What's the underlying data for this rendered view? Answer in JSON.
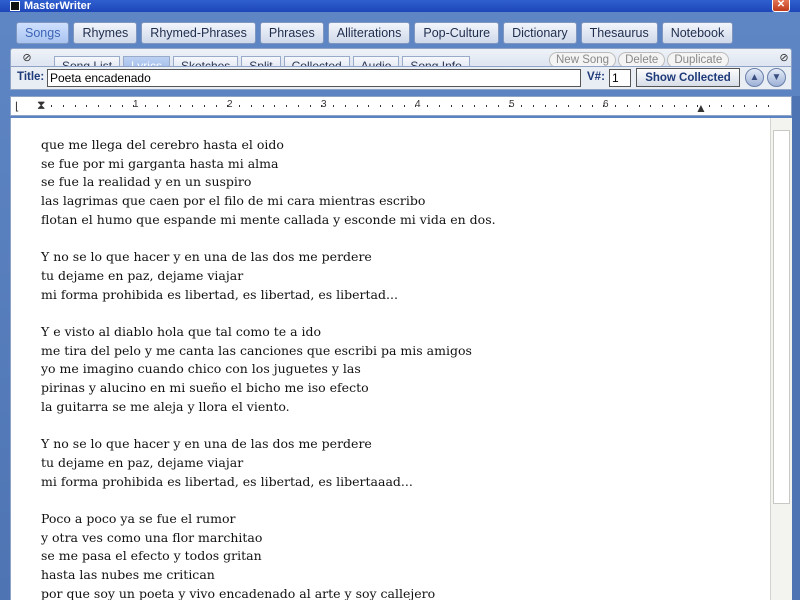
{
  "window": {
    "title": "MasterWriter"
  },
  "categories": [
    {
      "label": "Songs",
      "active": true
    },
    {
      "label": "Rhymes"
    },
    {
      "label": "Rhymed-Phrases"
    },
    {
      "label": "Phrases"
    },
    {
      "label": "Alliterations"
    },
    {
      "label": "Pop-Culture"
    },
    {
      "label": "Dictionary"
    },
    {
      "label": "Thesaurus"
    },
    {
      "label": "Notebook"
    }
  ],
  "song_tabs": [
    {
      "label": "Song List"
    },
    {
      "label": "Lyrics",
      "active": true
    },
    {
      "label": "Sketches"
    },
    {
      "label": "Split"
    },
    {
      "label": "Collected"
    },
    {
      "label": "Audio"
    },
    {
      "label": "Song Info"
    }
  ],
  "song_actions": {
    "new_song": "New Song",
    "delete": "Delete",
    "duplicate": "Duplicate"
  },
  "title_row": {
    "title_label": "Title:",
    "title_value": "Poeta encadenado",
    "version_label": "V#:",
    "version_value": "1",
    "show_collected": "Show Collected"
  },
  "ruler": {
    "numbers": [
      "1",
      "2",
      "3",
      "4",
      "5",
      "6"
    ]
  },
  "lyrics": [
    "que me llega del cerebro hasta el oido",
    "se fue por mi garganta hasta mi alma",
    "se fue la realidad y en un suspiro",
    "las lagrimas que caen por el filo de mi cara mientras escribo",
    "flotan el humo que espande mi mente callada y esconde mi vida en dos.",
    "",
    "Y no se lo que hacer y en una de las dos me perdere",
    "tu dejame en paz, dejame viajar",
    "mi forma prohibida es libertad, es libertad, es libertad...",
    "",
    "Y e visto al diablo hola que tal como te a ido",
    "me tira del pelo y me canta las canciones que escribi pa mis amigos",
    "yo me imagino cuando chico con los juguetes y las",
    "pirinas y alucino en mi sueño el bicho me iso efecto",
    "la guitarra se me aleja y llora el viento.",
    "",
    "Y no se lo que hacer y en una de las dos me perdere",
    "tu dejame en paz, dejame viajar",
    "mi forma prohibida es libertad, es libertad, es libertaaad...",
    "",
    "Poco a poco ya se fue el rumor",
    "y otra ves como una flor marchitao",
    "se me pasa el efecto y todos gritan",
    "hasta las nubes me critican",
    "por que soy un poeta y vivo encadenado al arte y soy callejero"
  ]
}
